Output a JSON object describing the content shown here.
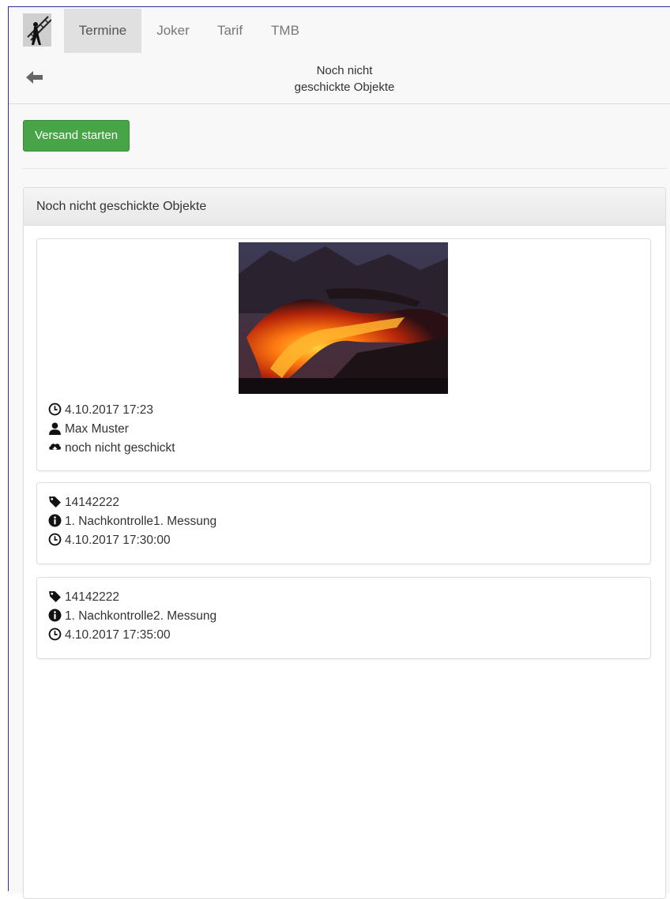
{
  "nav": {
    "tabs": [
      {
        "label": "Termine",
        "active": true
      },
      {
        "label": "Joker",
        "active": false
      },
      {
        "label": "Tarif",
        "active": false
      },
      {
        "label": "TMB",
        "active": false
      }
    ],
    "logo_icon": "chimney-sweep-icon"
  },
  "header": {
    "back_icon": "arrow-left-icon",
    "title_line1": "Noch nicht",
    "title_line2": "geschickte Objekte"
  },
  "actions": {
    "send_label": "Versand starten",
    "send_color": "#47a447"
  },
  "panel": {
    "heading": "Noch nicht geschickte Objekte",
    "photo_card": {
      "image_icon": "lava-photo",
      "datetime": "4.10.2017 17:23",
      "user": "Max Muster",
      "status": "noch nicht geschickt"
    },
    "items": [
      {
        "tag": "14142222",
        "info": "1. Nachkontrolle1. Messung",
        "datetime": "4.10.2017 17:30:00"
      },
      {
        "tag": "14142222",
        "info": "1. Nachkontrolle2. Messung",
        "datetime": "4.10.2017 17:35:00"
      }
    ]
  }
}
